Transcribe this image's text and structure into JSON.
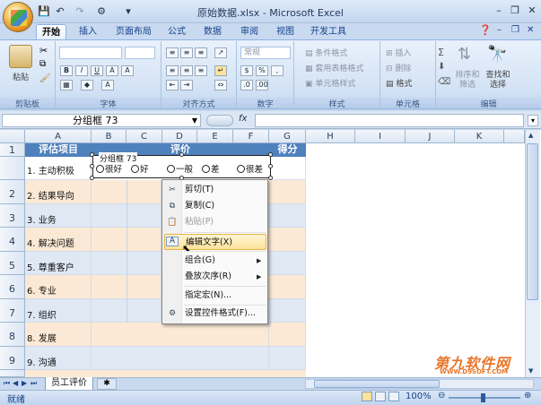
{
  "window": {
    "title": "原始数据.xlsx - Microsoft Excel"
  },
  "ribbon": {
    "tabs": [
      "开始",
      "插入",
      "页面布局",
      "公式",
      "数据",
      "审阅",
      "视图",
      "开发工具"
    ],
    "active_tab": "开始",
    "groups": {
      "clipboard": {
        "label": "剪贴板",
        "paste": "粘贴"
      },
      "font": {
        "label": "字体"
      },
      "alignment": {
        "label": "对齐方式"
      },
      "number": {
        "label": "数字",
        "format": "常规"
      },
      "styles": {
        "label": "样式",
        "items": [
          "条件格式",
          "套用表格格式",
          "单元格样式"
        ]
      },
      "cells": {
        "label": "单元格",
        "items": [
          "插入",
          "删除",
          "格式"
        ]
      },
      "editing": {
        "label": "编辑",
        "sort": "排序和筛选",
        "find": "查找和选择"
      }
    }
  },
  "formula_bar": {
    "name_box": "分组框 73",
    "fx": "fx",
    "value": ""
  },
  "columns": [
    "A",
    "B",
    "C",
    "D",
    "E",
    "F",
    "G",
    "H",
    "I",
    "J",
    "K"
  ],
  "rows": [
    "1",
    "2",
    "3",
    "4",
    "5",
    "6",
    "7",
    "8",
    "9",
    "10"
  ],
  "table": {
    "header_a": "评估项目",
    "header_mid": "评价",
    "header_g": "得分",
    "items": [
      "1. 主动积极",
      "2. 结果导向",
      "3. 业务",
      "4. 解决问题",
      "5. 尊重客户",
      "6. 专业",
      "7. 组织",
      "8. 发展",
      "9. 沟通"
    ]
  },
  "group_box": {
    "title": "分组框 73",
    "options": [
      "很好",
      "好",
      "一般",
      "差",
      "很差"
    ]
  },
  "context_menu": {
    "items": [
      {
        "label": "剪切(T)",
        "icon": "scissors-icon",
        "disabled": false
      },
      {
        "label": "复制(C)",
        "icon": "copy-icon",
        "disabled": false
      },
      {
        "label": "粘贴(P)",
        "icon": "paste-icon",
        "disabled": true
      },
      {
        "label": "编辑文字(X)",
        "icon": "edit-text-icon",
        "disabled": false,
        "highlighted": true
      },
      {
        "label": "组合(G)",
        "submenu": true
      },
      {
        "label": "叠放次序(R)",
        "submenu": true
      },
      {
        "label": "指定宏(N)..."
      },
      {
        "label": "设置控件格式(F)...",
        "icon": "format-control-icon"
      }
    ]
  },
  "sheet": {
    "tab": "员工评价"
  },
  "status": {
    "ready": "就绪",
    "zoom": "100%"
  },
  "watermark": {
    "line1": "第九软件网",
    "line2": "WWW.D9SOFT.COM"
  }
}
